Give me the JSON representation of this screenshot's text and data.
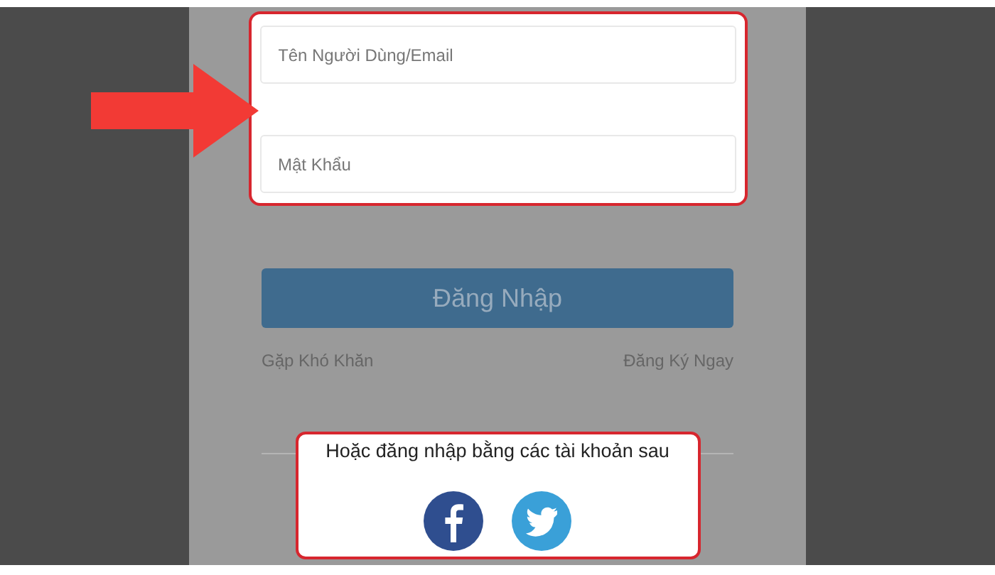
{
  "login_form": {
    "fields": [
      {
        "placeholder": "Tên Người Dùng/Email"
      },
      {
        "placeholder": "Mật Khẩu"
      }
    ],
    "login_button": "Đăng Nhập",
    "help_link": "Gặp Khó Khăn",
    "register_link": "Đăng Ký Ngay"
  },
  "social_login": {
    "prompt": "Hoặc đăng nhập bằng các tài khoản sau",
    "buttons": [
      {
        "kind": "facebook"
      },
      {
        "kind": "twitter"
      }
    ]
  }
}
